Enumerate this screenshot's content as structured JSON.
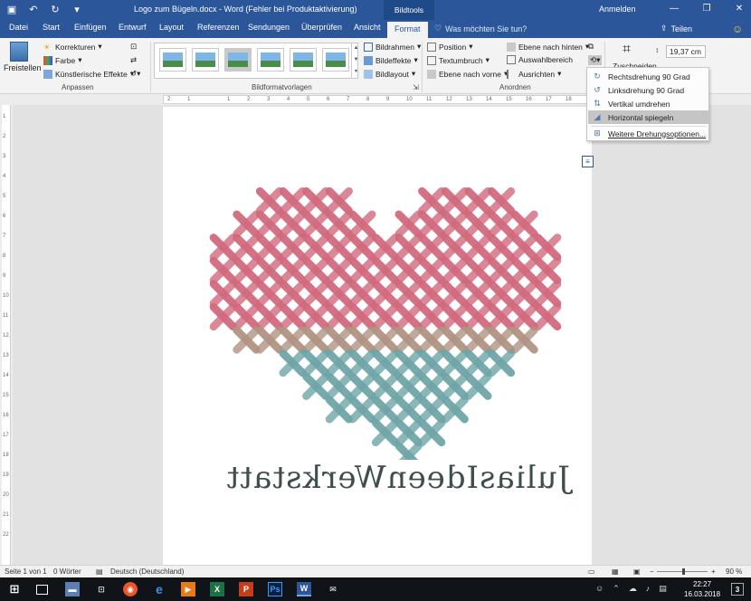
{
  "window": {
    "title": "Logo zum Bügeln.docx  -  Word (Fehler bei Produktaktivierung)",
    "context_tab": "Bildtools",
    "sign_in": "Anmelden",
    "minimize": "—",
    "restore": "❐",
    "close": "✕"
  },
  "tabs": [
    "Datei",
    "Start",
    "Einfügen",
    "Entwurf",
    "Layout",
    "Referenzen",
    "Sendungen",
    "Überprüfen",
    "Ansicht",
    "Format"
  ],
  "active_tab": "Format",
  "tell_me": "Was möchten Sie tun?",
  "share": "Teilen",
  "ribbon": {
    "freistellen": "Freistellen",
    "korrekturen": "Korrekturen",
    "farbe": "Farbe",
    "kuenstlerische_effekte": "Künstlerische Effekte",
    "group_anpassen": "Anpassen",
    "group_bildformatvorlagen": "Bildformatvorlagen",
    "bildrahmen": "Bildrahmen",
    "bildeffekte": "Bildeffekte",
    "bildlayout": "Bildlayout",
    "position": "Position",
    "textumbruch": "Textumbruch",
    "ebene_vorne": "Ebene nach vorne",
    "ebene_hinten": "Ebene nach hinten",
    "auswahlbereich": "Auswahlbereich",
    "ausrichten": "Ausrichten",
    "group_anordnen": "Anordnen",
    "zuschneiden": "Zuschneiden",
    "size_value": "19,37 cm"
  },
  "rotate_menu": {
    "items": [
      {
        "label": "Rechtsdrehung 90 Grad",
        "icon": "rotate-right-icon"
      },
      {
        "label": "Linksdrehung 90 Grad",
        "icon": "rotate-left-icon"
      },
      {
        "label": "Vertikal umdrehen",
        "icon": "flip-vertical-icon"
      },
      {
        "label": "Horizontal spiegeln",
        "icon": "flip-horizontal-icon"
      },
      {
        "label": "Weitere Drehungsoptionen...",
        "icon": "more-rotation-icon"
      }
    ],
    "highlighted": "Horizontal spiegeln"
  },
  "document": {
    "logo_text": "JuliasIdeenWerkstatt",
    "colors": {
      "pink": "#d26a7e",
      "brown": "#b19483",
      "teal": "#6fa6a8"
    }
  },
  "ruler": {
    "h_ticks": [
      "2",
      "1",
      "",
      "1",
      "2",
      "3",
      "4",
      "5",
      "6",
      "7",
      "8",
      "9",
      "10",
      "11",
      "12",
      "13",
      "14",
      "15",
      "16",
      "17",
      "18"
    ],
    "v_ticks": [
      "1",
      "2",
      "3",
      "4",
      "5",
      "6",
      "7",
      "8",
      "9",
      "10",
      "11",
      "12",
      "13",
      "14",
      "15",
      "16",
      "17",
      "18",
      "19",
      "20",
      "21",
      "22"
    ]
  },
  "status": {
    "page": "Seite 1 von 1",
    "words": "0 Wörter",
    "language": "Deutsch (Deutschland)",
    "zoom": "90 %",
    "minus": "−",
    "plus": "+"
  },
  "taskbar": {
    "time": "22:27",
    "date": "16.03.2018",
    "notif_count": "3"
  }
}
